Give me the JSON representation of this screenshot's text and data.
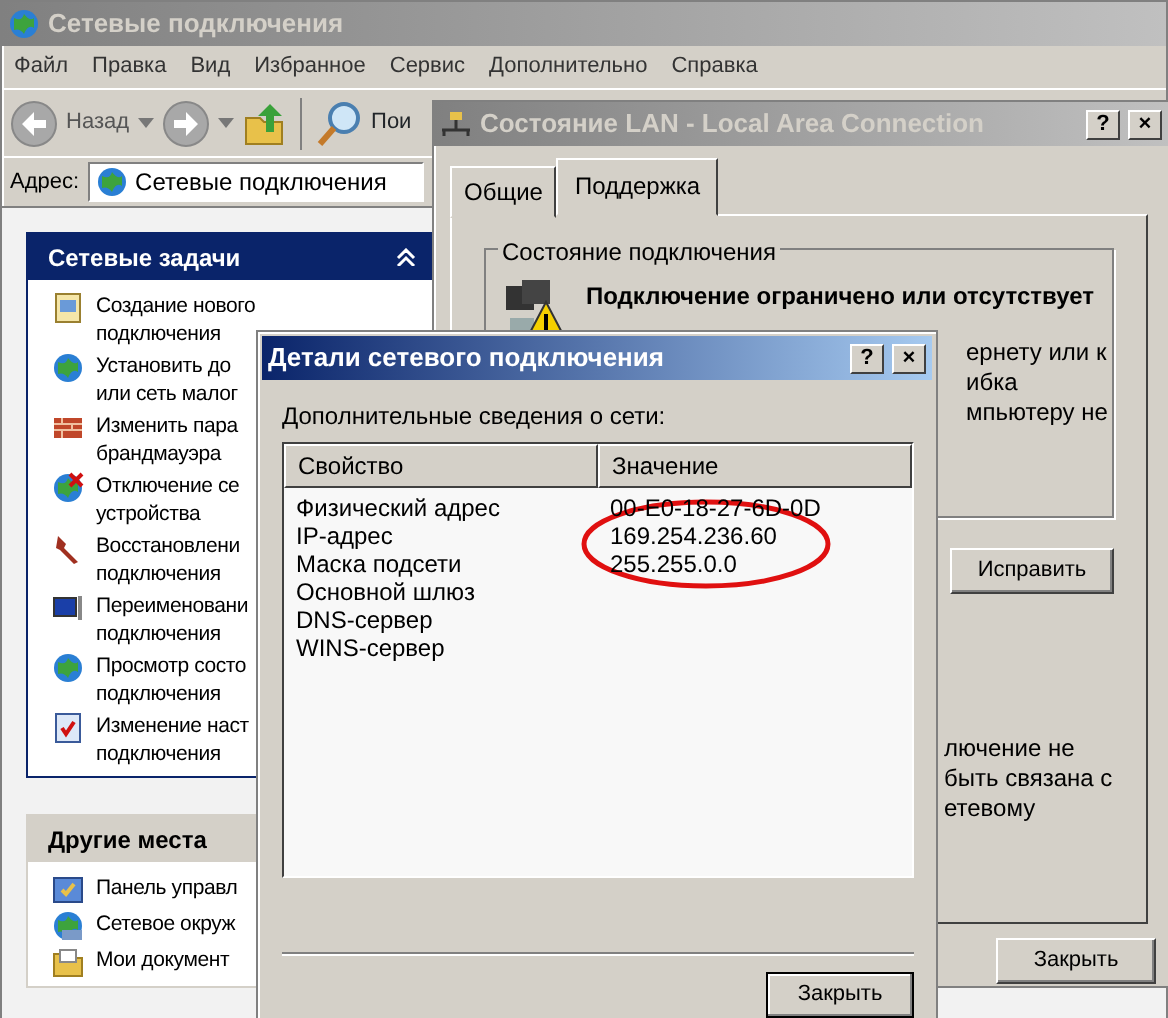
{
  "explorer": {
    "title": "Сетевые подключения",
    "menu": [
      "Файл",
      "Правка",
      "Вид",
      "Избранное",
      "Сервис",
      "Дополнительно",
      "Справка"
    ],
    "toolbar": {
      "back": "Назад",
      "search": "Пои"
    },
    "address": {
      "label": "Адрес:",
      "value": "Сетевые подключения"
    },
    "panels": [
      {
        "title": "Сетевые задачи",
        "kind": "special",
        "items": [
          {
            "lines": [
              "Создание нового",
              "подключения"
            ]
          },
          {
            "lines": [
              "Установить до",
              "или сеть малог"
            ]
          },
          {
            "lines": [
              "Изменить пара",
              "брандмауэра"
            ]
          },
          {
            "lines": [
              "Отключение се",
              "устройства"
            ]
          },
          {
            "lines": [
              "Восстановлени",
              "подключения"
            ]
          },
          {
            "lines": [
              "Переименовани",
              "подключения"
            ]
          },
          {
            "lines": [
              "Просмотр состо",
              "подключения"
            ]
          },
          {
            "lines": [
              "Изменение наст",
              "подключения"
            ]
          }
        ]
      },
      {
        "title": "Другие места",
        "kind": "normal",
        "items": [
          {
            "lines": [
              "Панель управл"
            ]
          },
          {
            "lines": [
              "Сетевое окруж"
            ]
          },
          {
            "lines": [
              "Мои документ"
            ]
          }
        ]
      }
    ]
  },
  "lan_window": {
    "title": "Состояние LAN - Local Area Connection",
    "title_buttons": [
      "?",
      "×"
    ],
    "tabs": [
      {
        "label": "Общие",
        "selected": false
      },
      {
        "label": "Поддержка",
        "selected": true
      }
    ],
    "group_title": "Состояние подключения",
    "status": "Подключение ограничено или отсутствует",
    "upper_fragments": [
      "ернету или к",
      "ибка",
      "мпьютеру не"
    ],
    "repair_button": "Исправить",
    "lower_fragments": [
      "лючение не",
      "быть связана с",
      "етевому"
    ],
    "close_button": "Закрыть"
  },
  "details_window": {
    "title": "Детали сетевого подключения",
    "title_buttons": [
      "?",
      "×"
    ],
    "caption": "Дополнительные сведения о сети:",
    "columns": [
      "Свойство",
      "Значение"
    ],
    "rows": [
      [
        "Физический адрес",
        "00-E0-18-27-6D-0D"
      ],
      [
        "IP-адрес",
        "169.254.236.60"
      ],
      [
        "Маска подсети",
        "255.255.0.0"
      ],
      [
        "Основной шлюз"
      ],
      [
        "DNS-сервер"
      ],
      [
        "WINS-сервер"
      ]
    ],
    "close_button": "Закрыть"
  }
}
